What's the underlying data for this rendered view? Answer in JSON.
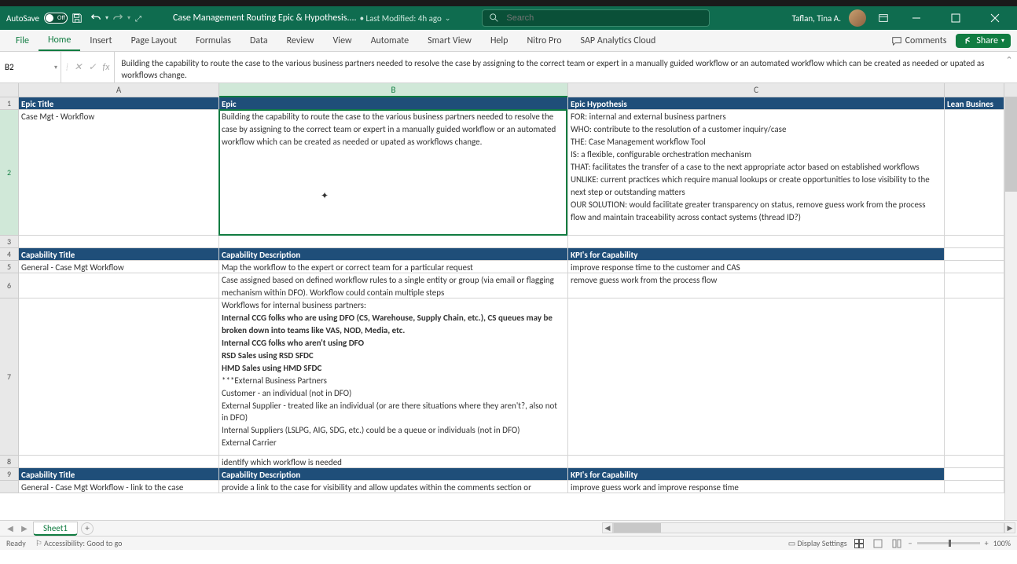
{
  "app": {
    "autosave_label": "AutoSave",
    "autosave_state": "Off",
    "doc_title": "Case Management Routing Epic & Hypothesis....",
    "last_modified": "• Last Modified: 4h ago",
    "search_placeholder": "Search",
    "user_name": "Taflan, Tina A."
  },
  "ribbon": {
    "tabs": [
      "File",
      "Home",
      "Insert",
      "Page Layout",
      "Formulas",
      "Data",
      "Review",
      "View",
      "Automate",
      "Smart View",
      "Help",
      "Nitro Pro",
      "SAP Analytics Cloud"
    ],
    "comments": "Comments",
    "share": "Share"
  },
  "formula": {
    "name_box": "B2",
    "text": "Building the capability to route the case to the various business partners needed to resolve the case by assigning to the correct team or expert in a manually guided workflow or an automated workflow which can be created as needed or upated as workflows change."
  },
  "columns": [
    "A",
    "B",
    "C"
  ],
  "row_numbers": [
    "1",
    "2",
    "3",
    "4",
    "5",
    "6",
    "7",
    "8",
    "9"
  ],
  "cells": {
    "r1": {
      "A": "Epic Title",
      "B": "Epic",
      "C": "Epic Hypothesis",
      "D": "Lean Busines"
    },
    "r2": {
      "A": "Case Mgt - Workflow",
      "B": "Building the capability to route the case to the various business partners needed to resolve the case by assigning to the correct team or expert in a manually guided workflow or an automated workflow which can be created as needed or upated as workflows change.",
      "C_lines": [
        "FOR: internal and external business partners",
        "WHO: contribute to the resolution of a customer inquiry/case",
        "THE: Case Management workflow Tool",
        "IS: a flexible, configurable orchestration mechanism",
        "THAT: facilitates the transfer of a case to the next appropriate actor based on established workflows",
        "UNLIKE: current practices which require manual lookups or create opportunities to lose visibility to the next step or outstanding matters",
        "OUR SOLUTION: would facilitate greater transparency on status, remove guess work from the process flow and maintain traceability across contact systems (thread ID?)"
      ]
    },
    "r4": {
      "A": "Capability Title",
      "B": "Capability Description",
      "C": "KPI's for Capability"
    },
    "r5": {
      "A": "General - Case Mgt Workflow",
      "B": "Map the workflow to the expert or correct team for a particular request",
      "C": "improve response time to the customer and CAS"
    },
    "r6": {
      "A": "",
      "B": "Case assigned based on defined workflow rules to a single entity or group (via email or flagging mechanism within DFO). Workflow could contain multiple steps",
      "C": "remove guess work from the process flow"
    },
    "r7": {
      "A": "",
      "B_lines": [
        {
          "t": "Workflows for internal business partners:",
          "b": false
        },
        {
          "t": "Internal CCG folks who are using DFO (CS, Warehouse, Supply Chain, etc.), CS queues may be broken down into teams like VAS, NOD, Media, etc.",
          "b": true
        },
        {
          "t": "Internal CCG folks who aren't using DFO",
          "b": true
        },
        {
          "t": "RSD Sales using RSD SFDC",
          "b": true
        },
        {
          "t": "HMD Sales using HMD SFDC",
          "b": true
        },
        {
          "t": "***External Business Partners",
          "b": false
        },
        {
          "t": "Customer - an individual (not in DFO)",
          "b": false
        },
        {
          "t": "External Supplier - treated like an individual (or are there situations where they aren't?, also not in DFO)",
          "b": false
        },
        {
          "t": "Internal Suppliers (LSLPG, AIG, SDG, etc.) could be a queue or individuals (not in DFO)",
          "b": false
        },
        {
          "t": "External Carrier",
          "b": false
        }
      ],
      "C": ""
    },
    "r8": {
      "A": "",
      "B": "identify which workflow is needed",
      "C": ""
    },
    "r9": {
      "A": "Capability Title",
      "B": "Capability Description",
      "C": "KPI's for Capability"
    },
    "r9b": {
      "A": "General - Case Mgt Workflow - link to the case",
      "B": "provide a link to the case for visibility and allow updates within the comments section or",
      "C": "improve guess work and improve response time"
    }
  },
  "sheet_tabs": {
    "active": "Sheet1"
  },
  "status": {
    "ready": "Ready",
    "accessibility": "Accessibility: Good to go",
    "display_settings": "Display Settings",
    "zoom": "100%"
  }
}
